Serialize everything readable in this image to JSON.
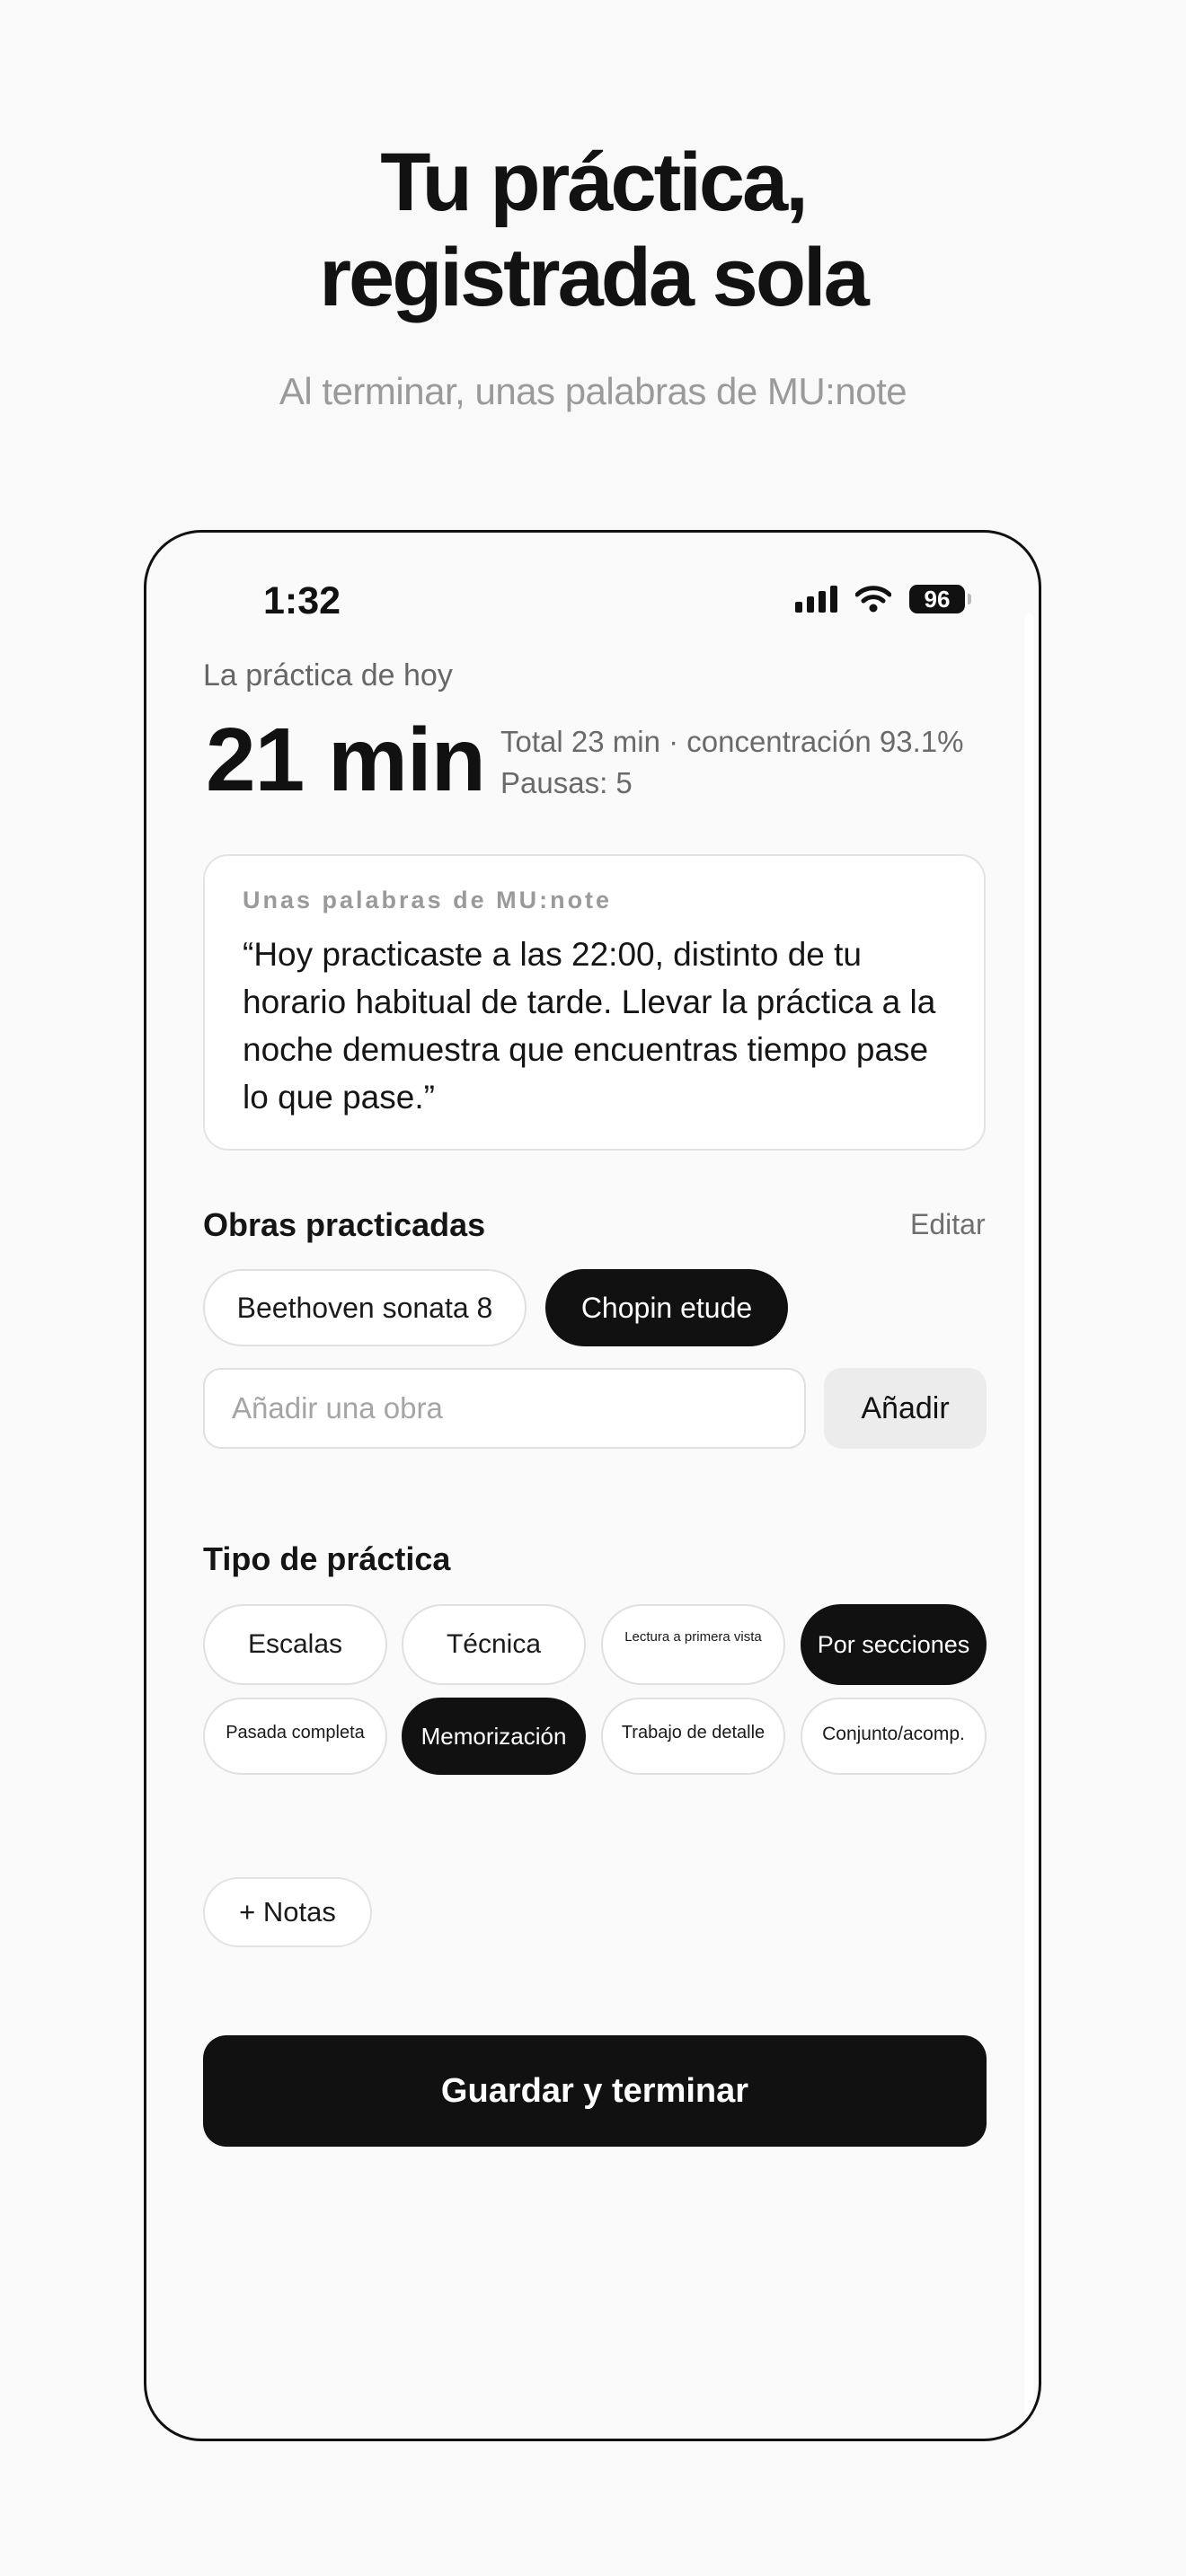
{
  "hero": {
    "title_line1": "Tu práctica,",
    "title_line2": "registrada sola",
    "subtitle": "Al terminar, unas palabras de MU:note"
  },
  "status_bar": {
    "time": "1:32",
    "battery": "96",
    "icons": [
      "signal-icon",
      "wifi-icon",
      "battery-icon"
    ]
  },
  "summary": {
    "label": "La práctica de hoy",
    "minutes": "21 min",
    "stats_line1": "Total 23 min · concentración 93.1%",
    "stats_line2": "Pausas: 5"
  },
  "note": {
    "title": "Unas palabras de MU:note",
    "text": "“Hoy practicaste a las 22:00, distinto de tu horario habitual de tarde. Llevar la práctica a la noche demuestra que encuentras tiempo pase lo que pase.”"
  },
  "pieces": {
    "title": "Obras practicadas",
    "edit_label": "Editar",
    "items": [
      {
        "label": "Beethoven sonata 8",
        "selected": false
      },
      {
        "label": "Chopin etude",
        "selected": true
      }
    ],
    "input_placeholder": "Añadir una obra",
    "add_label": "Añadir"
  },
  "practice_type": {
    "title": "Tipo de práctica",
    "options": [
      {
        "label": "Escalas",
        "selected": false
      },
      {
        "label": "Técnica",
        "selected": false
      },
      {
        "label": "Lectura a primera vista",
        "selected": false
      },
      {
        "label": "Por secciones",
        "selected": true
      },
      {
        "label": "Pasada completa",
        "selected": false
      },
      {
        "label": "Memorización",
        "selected": true
      },
      {
        "label": "Trabajo de detalle",
        "selected": false
      },
      {
        "label": "Conjunto/acomp.",
        "selected": false
      }
    ]
  },
  "notes_label": "+ Notas",
  "save_label": "Guardar y terminar",
  "colors": {
    "accent": "#111111",
    "background": "#F9F9F9",
    "muted_text": "#9A9A9A",
    "chip_border": "#E0E0E0"
  }
}
